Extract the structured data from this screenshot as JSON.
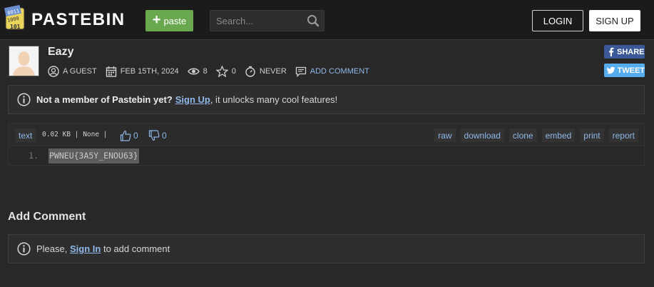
{
  "header": {
    "logo_icon": "pastebin-logo-icon",
    "logo_text": "PASTEBIN",
    "paste_button_label": "paste",
    "search_placeholder": "Search...",
    "login_label": "LOGIN",
    "signup_label": "SIGN UP"
  },
  "paste": {
    "title": "Eazy",
    "author": "A GUEST",
    "date": "FEB 15TH, 2024",
    "views": "8",
    "stars": "0",
    "expiration": "NEVER",
    "add_comment_label": "ADD COMMENT",
    "share_label": "SHARE",
    "tweet_label": "TWEET"
  },
  "notice": {
    "bold_text": "Not a member of Pastebin yet?",
    "link_text": "Sign Up",
    "rest_text": ", it unlocks many cool features!"
  },
  "code": {
    "syntax_label": "text",
    "size_info": "0.02 KB | None |",
    "likes": "0",
    "dislikes": "0",
    "actions": [
      "raw",
      "download",
      "clone",
      "embed",
      "print",
      "report"
    ],
    "lines": [
      {
        "number": "1.",
        "text": "PWNEU{3A5Y_ENOU63}"
      }
    ]
  },
  "comments": {
    "heading": "Add Comment",
    "prompt_prefix": "Please,",
    "signin_link": "Sign In",
    "prompt_suffix": "to add comment"
  },
  "colors": {
    "background": "#282828",
    "header": "#1b1b1b",
    "accent_green": "#6aa84f",
    "link_blue": "#8fb8e8",
    "facebook": "#3b5998",
    "twitter": "#55acee"
  }
}
